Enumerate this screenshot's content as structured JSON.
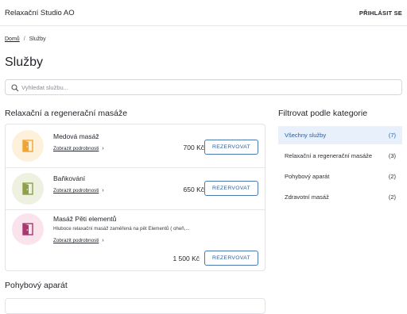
{
  "header": {
    "brand": "Relaxační Studio AO",
    "login_label": "PŘIHLÁSIT SE"
  },
  "breadcrumb": {
    "home": "Domů",
    "separator": "/",
    "current": "Služby"
  },
  "page_title": "Služby",
  "search": {
    "placeholder": "Vyhledat službu...",
    "value": "",
    "icon": "search-icon"
  },
  "sections": [
    {
      "title": "Relaxační a regenerační masáže",
      "services": [
        {
          "name": "Medová masáž",
          "description": "",
          "link": "Zobrazit podrobnosti",
          "price": "700 Kč",
          "button": "REZERVOVAT",
          "icon": "door-icon",
          "icon_color": "#f0a532",
          "bg_color": "#fdf1dc"
        },
        {
          "name": "Baňkování",
          "description": "",
          "link": "Zobrazit podrobnosti",
          "price": "650 Kč",
          "button": "REZERVOVAT",
          "icon": "door-icon",
          "icon_color": "#8da14a",
          "bg_color": "#eef1e0"
        },
        {
          "name": "Masáž Pěti elementů",
          "description": "Hluboce relaxační masáž zaměřená na pět Elementů ( oheň,...",
          "link": "Zobrazit podrobnosti",
          "price": "1 500 Kč",
          "button": "REZERVOVAT",
          "icon": "door-icon",
          "icon_color": "#a8386f",
          "bg_color": "#fbe3ee"
        }
      ]
    },
    {
      "title": "Pohybový aparát",
      "services": []
    }
  ],
  "filter": {
    "title": "Filtrovat podle kategorie",
    "items": [
      {
        "label": "Všechny služby",
        "count": "(7)",
        "active": true
      },
      {
        "label": "Relaxační a regenerační masáže",
        "count": "(3)",
        "active": false
      },
      {
        "label": "Pohybový aparát",
        "count": "(2)",
        "active": false
      },
      {
        "label": "Zdravotní masáž",
        "count": "(2)",
        "active": false
      }
    ]
  },
  "colors": {
    "accent": "#4a78b0",
    "active_bg": "#e8f0fc",
    "active_text": "#1f5fae"
  }
}
